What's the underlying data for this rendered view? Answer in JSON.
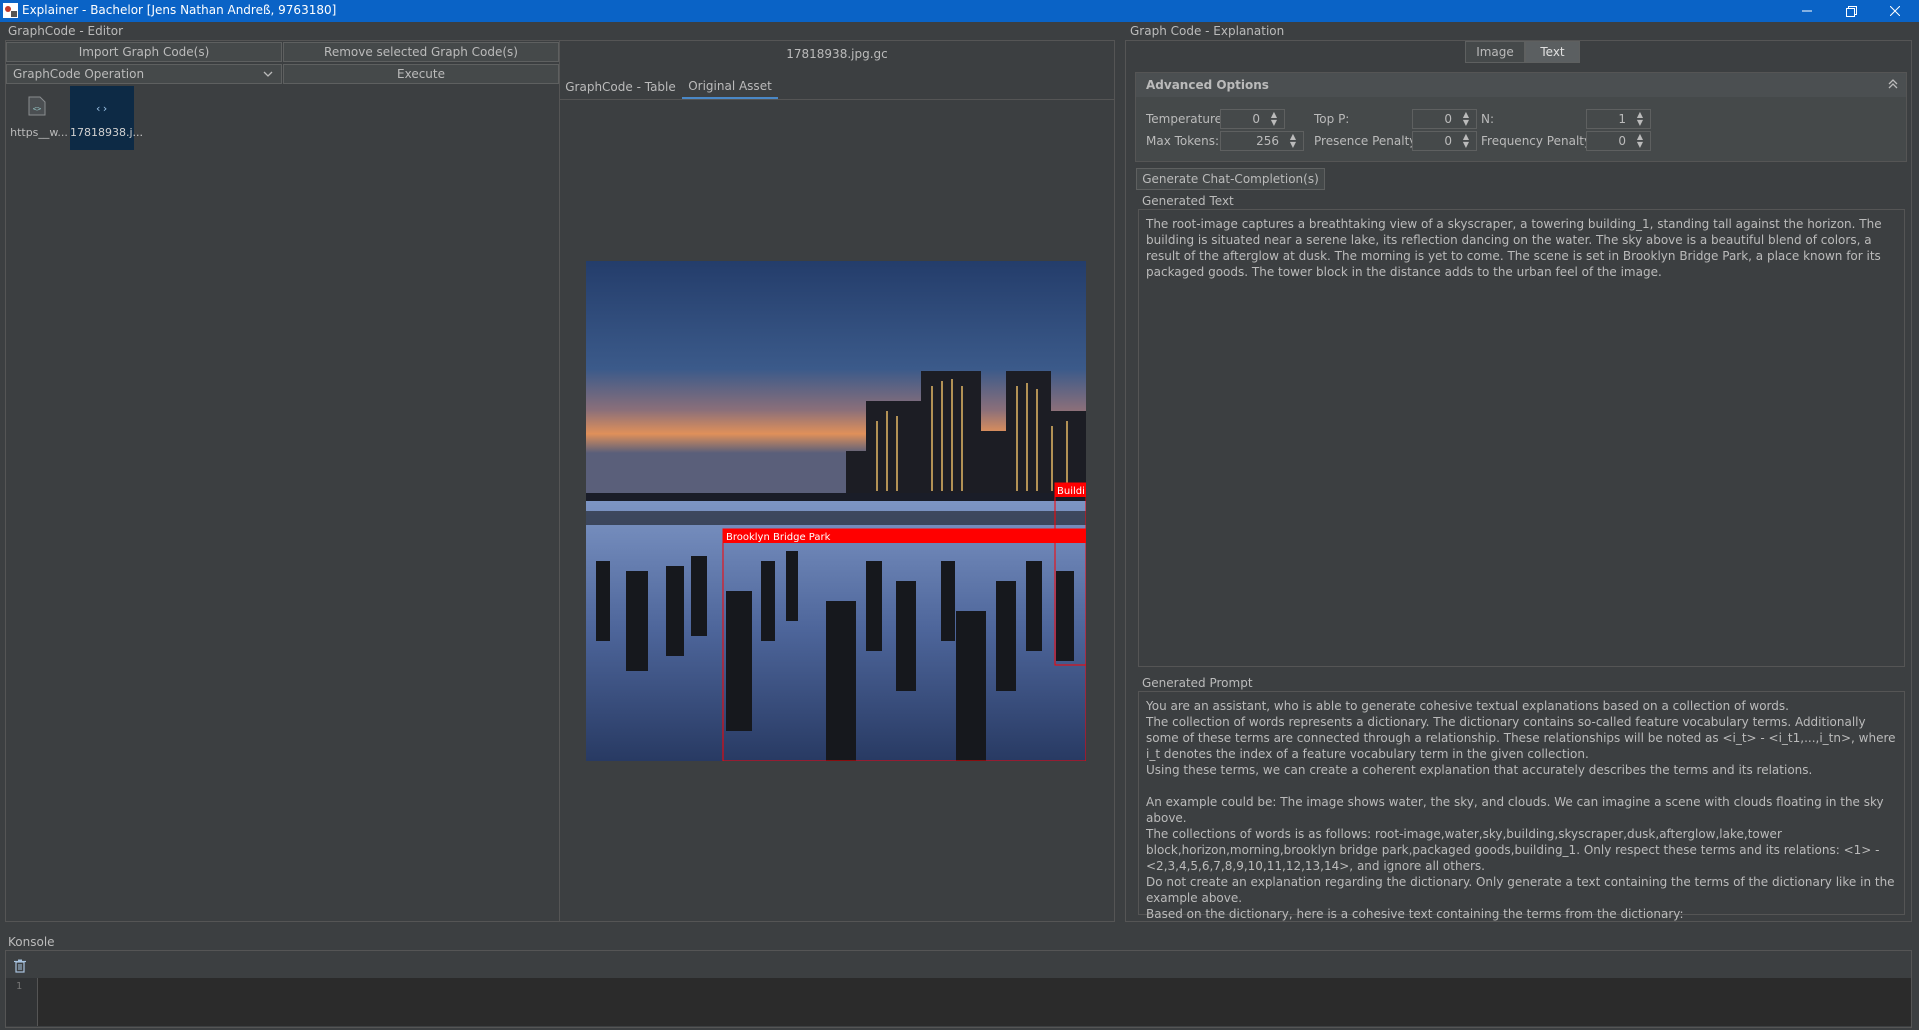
{
  "window": {
    "title": "Explainer - Bachelor [Jens Nathan Andreß, 9763180]"
  },
  "editor": {
    "title": "GraphCode - Editor",
    "import_label": "Import Graph Code(s)",
    "remove_label": "Remove selected Graph Code(s)",
    "operation_label": "GraphCode Operation",
    "execute_label": "Execute",
    "files": [
      {
        "name": "https__w..."
      },
      {
        "name": "17818938.j..."
      }
    ]
  },
  "viewer": {
    "filename": "17818938.jpg.gc",
    "tabs": [
      {
        "label": "GraphCode - Table"
      },
      {
        "label": "Original Asset"
      }
    ],
    "boxes": [
      {
        "label": "Brooklyn Bridge Park"
      },
      {
        "label": "Buildi"
      }
    ]
  },
  "explanation": {
    "title": "Graph Code - Explanation",
    "toggle": [
      {
        "label": "Image"
      },
      {
        "label": "Text"
      }
    ],
    "advanced_title": "Advanced Options",
    "options": {
      "temperature": {
        "label": "Temperature:",
        "value": "0"
      },
      "top_p": {
        "label": "Top P:",
        "value": "0"
      },
      "n": {
        "label": "N:",
        "value": "1"
      },
      "max_tokens": {
        "label": "Max Tokens:",
        "value": "256"
      },
      "presence_penalty": {
        "label": "Presence Penalty:",
        "value": "0"
      },
      "frequency_penalty": {
        "label": "Frequency Penalty:",
        "value": "0"
      }
    },
    "generate_label": "Generate Chat-Completion(s)",
    "generated_text_title": "Generated Text",
    "generated_text": "The root-image captures a breathtaking view of a skyscraper, a towering building_1, standing tall against the horizon. The building is situated near a serene lake, its reflection dancing on the water. The sky above is a beautiful blend of colors, a result of the afterglow at dusk. The morning is yet to come. The scene is set in Brooklyn Bridge Park, a place known for its packaged goods. The tower block in the distance adds to the urban feel of the image.",
    "generated_prompt_title": "Generated Prompt",
    "generated_prompt": "You are an assistant, who is able to generate cohesive textual explanations based on a collection of words.\nThe collection of words represents a dictionary. The dictionary contains so-called feature vocabulary terms. Additionally some of these terms are connected through a relationship. These relationships will be noted as <i_t> - <i_t1,...,i_tn>, where i_t denotes the index of a feature vocabulary term in the given collection.\nUsing these terms, we can create a coherent explanation that accurately describes the terms and its relations.\n\nAn example could be: The image shows water, the sky, and clouds. We can imagine a scene with clouds floating in the sky above.\nThe collections of words is as follows: root-image,water,sky,building,skyscraper,dusk,afterglow,lake,tower block,horizon,morning,brooklyn bridge park,packaged goods,building_1. Only respect these terms and its relations: <1> - <2,3,4,5,6,7,8,9,10,11,12,13,14>, and ignore all others.\nDo not create an explanation regarding the dictionary. Only generate a text containing the terms of the dictionary like in the example above.\nBased on the dictionary, here is a cohesive text containing the terms from the dictionary:"
  },
  "console": {
    "title": "Konsole",
    "line_number": "1"
  },
  "colors": {
    "accent": "#4a88c7",
    "titlebar": "#0a63c6",
    "box": "#ff0000"
  }
}
